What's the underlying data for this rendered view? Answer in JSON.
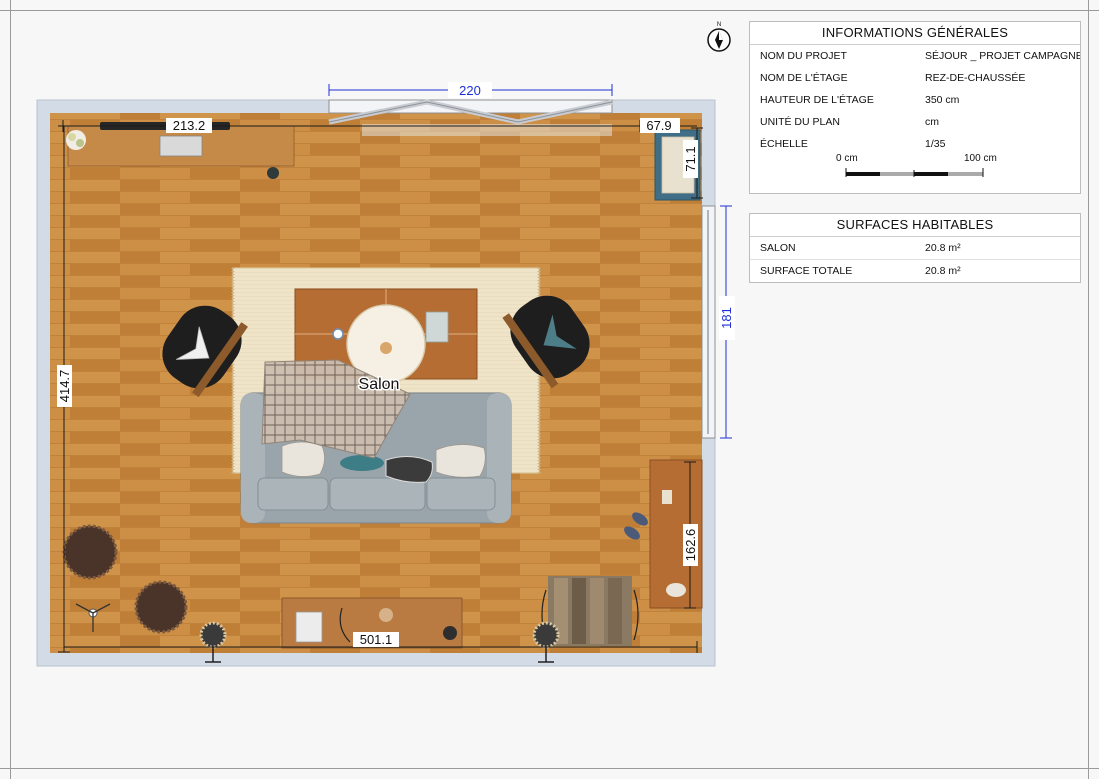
{
  "plan": {
    "room_label": "Salon",
    "dimensions": {
      "window_top": "220",
      "window_right": "181",
      "tv_unit": "213.2",
      "cabinet_top_right": "67.9",
      "cabinet_side": "71.1",
      "room_height": "414.7",
      "desk_length": "162.6",
      "room_width": "501.1"
    }
  },
  "compass": {
    "north_label": "N"
  },
  "info_panel": {
    "title": "INFORMATIONS GÉNÉRALES",
    "rows": [
      {
        "key": "NOM DU PROJET",
        "value": "SÉJOUR _ PROJET CAMPAGNE"
      },
      {
        "key": "NOM DE L'ÉTAGE",
        "value": "REZ-DE-CHAUSSÉE"
      },
      {
        "key": "HAUTEUR DE L'ÉTAGE",
        "value": "350 cm"
      },
      {
        "key": "UNITÉ DU PLAN",
        "value": "cm"
      },
      {
        "key": "ÉCHELLE",
        "value": "1/35"
      }
    ],
    "scale_start": "0 cm",
    "scale_end": "100 cm"
  },
  "surfaces_panel": {
    "title": "SURFACES HABITABLES",
    "rows": [
      {
        "key": "SALON",
        "value": "20.8 m²"
      },
      {
        "key": "SURFACE TOTALE",
        "value": "20.8 m²"
      }
    ]
  },
  "colors": {
    "floor": "#c8893f",
    "wall": "#d3dbe6",
    "dimension_blue": "#1d2fd6",
    "sofa": "#9aa5ab",
    "chair": "#1e1e1e",
    "rug": "#efe3c8",
    "table_wood": "#b66d33",
    "cabinet_teal": "#3f6e86"
  }
}
